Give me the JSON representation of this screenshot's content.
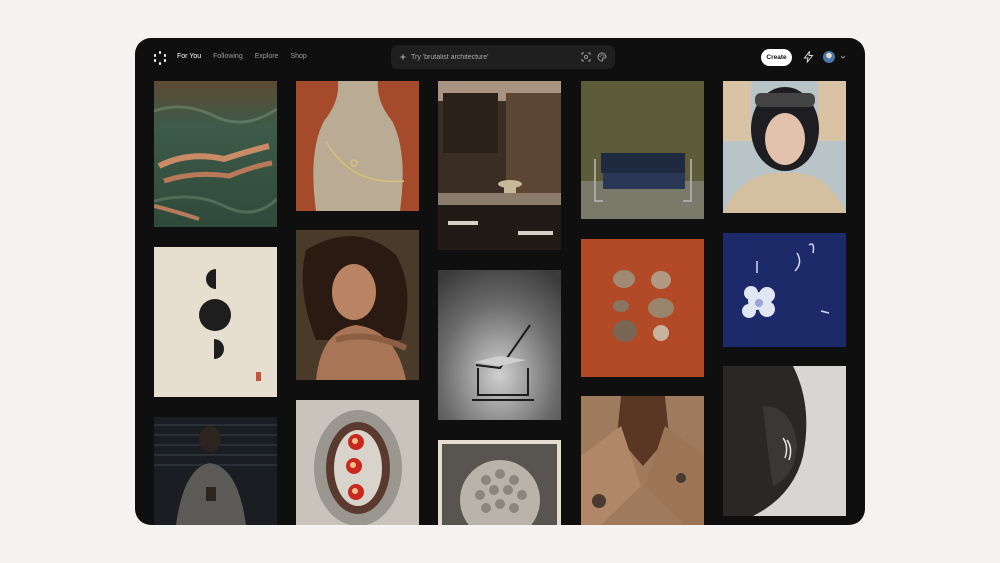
{
  "nav": {
    "items": [
      {
        "label": "For You",
        "active": true
      },
      {
        "label": "Following"
      },
      {
        "label": "Explore"
      },
      {
        "label": "Shop"
      }
    ]
  },
  "search": {
    "placeholder": "Try 'brutalist architecture'"
  },
  "actions": {
    "create_label": "Create"
  },
  "feed": {
    "images": [
      "swimmers-in-green-water",
      "ceramic-vase-with-wire",
      "wooden-kitchen-interior",
      "blue-sofa-in-room",
      "portrait-with-goggles",
      "abstract-circles-print",
      "portrait-curly-hair",
      "steel-tube-chair",
      "terracotta-stones",
      "blue-cyanotype-flowers",
      "man-in-dark-room",
      "plate-with-red-fruit",
      "sculptural-sphere",
      "patterned-shirt",
      "ear-with-earrings"
    ]
  },
  "colors": {
    "app_bg": "#0f0f0f",
    "page_bg": "#f4f3f1",
    "search_bg": "#1f1f1f"
  }
}
